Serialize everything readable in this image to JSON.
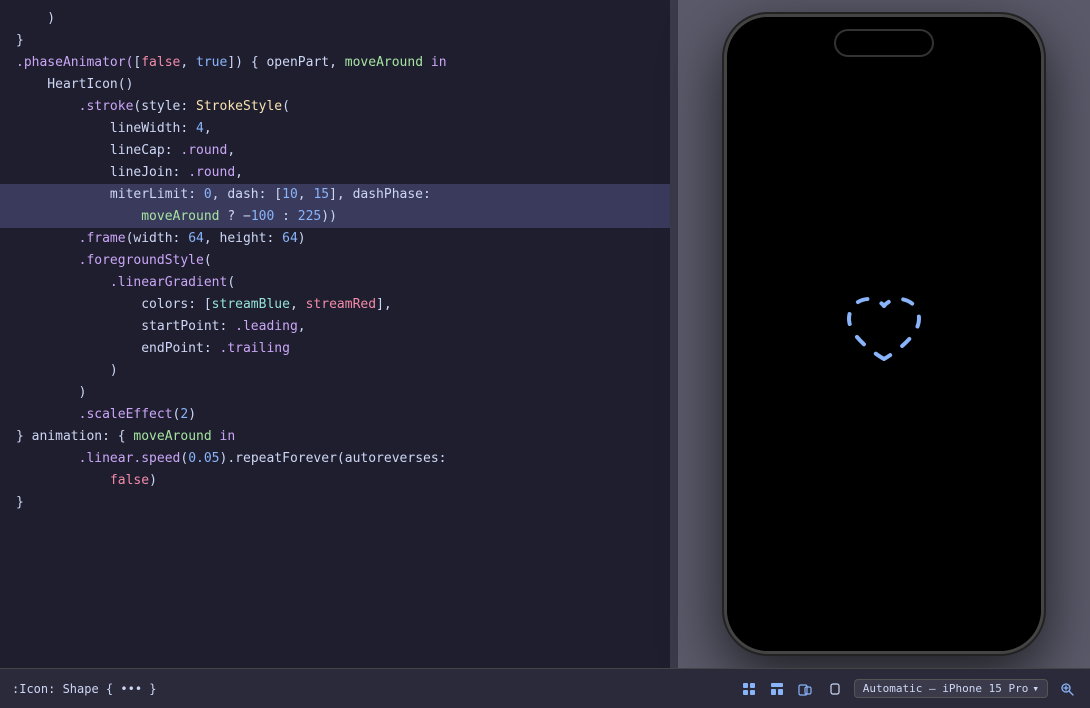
{
  "code": {
    "lines": [
      {
        "id": 1,
        "tokens": [
          {
            "text": "    )",
            "cls": "c-white"
          }
        ],
        "highlighted": false
      },
      {
        "id": 2,
        "tokens": [
          {
            "text": "}",
            "cls": "c-white"
          }
        ],
        "highlighted": false
      },
      {
        "id": 3,
        "tokens": [
          {
            "text": ".phaseAnimator(",
            "cls": "c-purple"
          },
          {
            "text": "[",
            "cls": "c-white"
          },
          {
            "text": "false",
            "cls": "c-pink"
          },
          {
            "text": ", ",
            "cls": "c-white"
          },
          {
            "text": "true",
            "cls": "c-blue"
          },
          {
            "text": "]) { ",
            "cls": "c-white"
          },
          {
            "text": "openPart",
            "cls": "c-text"
          },
          {
            "text": ", ",
            "cls": "c-white"
          },
          {
            "text": "moveAround",
            "cls": "c-green"
          },
          {
            "text": " in",
            "cls": "c-purple"
          }
        ],
        "highlighted": false
      },
      {
        "id": 4,
        "tokens": [
          {
            "text": "    HeartIcon()",
            "cls": "c-text"
          }
        ],
        "highlighted": false
      },
      {
        "id": 5,
        "tokens": [
          {
            "text": "        .stroke",
            "cls": "c-purple"
          },
          {
            "text": "(",
            "cls": "c-white"
          },
          {
            "text": "style",
            "cls": "c-text"
          },
          {
            "text": ": ",
            "cls": "c-white"
          },
          {
            "text": "StrokeStyle",
            "cls": "c-yellow"
          },
          {
            "text": "(",
            "cls": "c-white"
          }
        ],
        "highlighted": false
      },
      {
        "id": 6,
        "tokens": [
          {
            "text": "            lineWidth",
            "cls": "c-text"
          },
          {
            "text": ": ",
            "cls": "c-white"
          },
          {
            "text": "4",
            "cls": "c-blue"
          },
          {
            "text": ",",
            "cls": "c-white"
          }
        ],
        "highlighted": false
      },
      {
        "id": 7,
        "tokens": [
          {
            "text": "            lineCap",
            "cls": "c-text"
          },
          {
            "text": ": ",
            "cls": "c-white"
          },
          {
            "text": ".round",
            "cls": "c-mauve"
          },
          {
            "text": ",",
            "cls": "c-white"
          }
        ],
        "highlighted": false
      },
      {
        "id": 8,
        "tokens": [
          {
            "text": "            lineJoin",
            "cls": "c-text"
          },
          {
            "text": ": ",
            "cls": "c-white"
          },
          {
            "text": ".round",
            "cls": "c-mauve"
          },
          {
            "text": ",",
            "cls": "c-white"
          }
        ],
        "highlighted": false
      },
      {
        "id": 9,
        "tokens": [
          {
            "text": "            miterLimit",
            "cls": "c-text"
          },
          {
            "text": ": ",
            "cls": "c-white"
          },
          {
            "text": "0",
            "cls": "c-blue"
          },
          {
            "text": ", dash: [",
            "cls": "c-white"
          },
          {
            "text": "10",
            "cls": "c-blue"
          },
          {
            "text": ", ",
            "cls": "c-white"
          },
          {
            "text": "15",
            "cls": "c-blue"
          },
          {
            "text": "], dashPhase:",
            "cls": "c-white"
          }
        ],
        "highlighted": true
      },
      {
        "id": 10,
        "tokens": [
          {
            "text": "                moveAround",
            "cls": "c-green"
          },
          {
            "text": " ? ",
            "cls": "c-white"
          },
          {
            "text": "−",
            "cls": "c-white"
          },
          {
            "text": "100",
            "cls": "c-blue"
          },
          {
            "text": " : ",
            "cls": "c-white"
          },
          {
            "text": "225",
            "cls": "c-blue"
          },
          {
            "text": "))",
            "cls": "c-white"
          }
        ],
        "highlighted": true
      },
      {
        "id": 11,
        "tokens": [
          {
            "text": "        .frame",
            "cls": "c-purple"
          },
          {
            "text": "(",
            "cls": "c-white"
          },
          {
            "text": "width",
            "cls": "c-text"
          },
          {
            "text": ": ",
            "cls": "c-white"
          },
          {
            "text": "64",
            "cls": "c-blue"
          },
          {
            "text": ", ",
            "cls": "c-white"
          },
          {
            "text": "height",
            "cls": "c-text"
          },
          {
            "text": ": ",
            "cls": "c-white"
          },
          {
            "text": "64",
            "cls": "c-blue"
          },
          {
            "text": ")",
            "cls": "c-white"
          }
        ],
        "highlighted": false
      },
      {
        "id": 12,
        "tokens": [
          {
            "text": "        .foregroundStyle",
            "cls": "c-purple"
          },
          {
            "text": "(",
            "cls": "c-white"
          }
        ],
        "highlighted": false
      },
      {
        "id": 13,
        "tokens": [
          {
            "text": "            .linearGradient",
            "cls": "c-purple"
          },
          {
            "text": "(",
            "cls": "c-white"
          }
        ],
        "highlighted": false
      },
      {
        "id": 14,
        "tokens": [
          {
            "text": "                colors",
            "cls": "c-text"
          },
          {
            "text": ": [",
            "cls": "c-white"
          },
          {
            "text": "streamBlue",
            "cls": "c-teal"
          },
          {
            "text": ", ",
            "cls": "c-white"
          },
          {
            "text": "streamRed",
            "cls": "c-red"
          },
          {
            "text": "],",
            "cls": "c-white"
          }
        ],
        "highlighted": false
      },
      {
        "id": 15,
        "tokens": [
          {
            "text": "                startPoint",
            "cls": "c-text"
          },
          {
            "text": ": ",
            "cls": "c-white"
          },
          {
            "text": ".leading",
            "cls": "c-mauve"
          },
          {
            "text": ",",
            "cls": "c-white"
          }
        ],
        "highlighted": false
      },
      {
        "id": 16,
        "tokens": [
          {
            "text": "                endPoint",
            "cls": "c-text"
          },
          {
            "text": ": ",
            "cls": "c-white"
          },
          {
            "text": ".trailing",
            "cls": "c-mauve"
          }
        ],
        "highlighted": false
      },
      {
        "id": 17,
        "tokens": [
          {
            "text": "            )",
            "cls": "c-white"
          }
        ],
        "highlighted": false
      },
      {
        "id": 18,
        "tokens": [
          {
            "text": "        )",
            "cls": "c-white"
          }
        ],
        "highlighted": false
      },
      {
        "id": 19,
        "tokens": [
          {
            "text": "        .scaleEffect",
            "cls": "c-purple"
          },
          {
            "text": "(",
            "cls": "c-white"
          },
          {
            "text": "2",
            "cls": "c-blue"
          },
          {
            "text": ")",
            "cls": "c-white"
          }
        ],
        "highlighted": false
      },
      {
        "id": 20,
        "tokens": [
          {
            "text": "} animation",
            "cls": "c-white"
          },
          {
            "text": ": { ",
            "cls": "c-white"
          },
          {
            "text": "moveAround",
            "cls": "c-green"
          },
          {
            "text": " in",
            "cls": "c-purple"
          }
        ],
        "highlighted": false
      },
      {
        "id": 21,
        "tokens": [
          {
            "text": "        .linear.speed",
            "cls": "c-purple"
          },
          {
            "text": "(",
            "cls": "c-white"
          },
          {
            "text": "0.05",
            "cls": "c-blue"
          },
          {
            "text": ").repeatForever(",
            "cls": "c-white"
          },
          {
            "text": "autoreverses",
            "cls": "c-text"
          },
          {
            "text": ":",
            "cls": "c-white"
          }
        ],
        "highlighted": false
      },
      {
        "id": 22,
        "tokens": [
          {
            "text": "            ",
            "cls": "c-white"
          },
          {
            "text": "false",
            "cls": "c-pink"
          },
          {
            "text": ")",
            "cls": "c-white"
          }
        ],
        "highlighted": false
      },
      {
        "id": 23,
        "tokens": [
          {
            "text": "}",
            "cls": "c-white"
          }
        ],
        "highlighted": false
      }
    ]
  },
  "bottom_bar": {
    "code_snippet": ":Icon: Shape { ••• }",
    "shape_label": "Shape",
    "device_label": "Automatic – iPhone 15 Pro",
    "icons": [
      "grid-icon",
      "layout-icon",
      "devices-icon"
    ]
  },
  "preview": {
    "phone_model": "iPhone 15 Pro"
  }
}
